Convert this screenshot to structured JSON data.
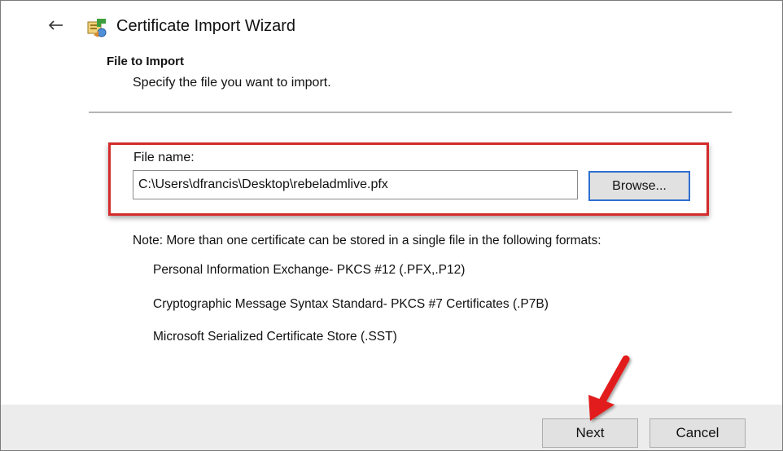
{
  "window": {
    "title": "Certificate Import Wizard"
  },
  "icons": {
    "back": "back-arrow-icon",
    "wizard": "certificate-wizard-icon"
  },
  "page": {
    "heading": "File to Import",
    "description": "Specify the file you want to import."
  },
  "file": {
    "label": "File name:",
    "value": "C:\\Users\\dfrancis\\Desktop\\rebeladmlive.pfx",
    "browse_label": "Browse..."
  },
  "note": {
    "text": "Note:  More than one certificate can be stored in a single file in the following formats:",
    "formats": [
      "Personal Information Exchange- PKCS #12 (.PFX,.P12)",
      "Cryptographic Message Syntax Standard- PKCS #7 Certificates (.P7B)",
      "Microsoft Serialized Certificate Store (.SST)"
    ]
  },
  "footer": {
    "next_label": "Next",
    "cancel_label": "Cancel"
  },
  "colors": {
    "highlight": "#d42b2b",
    "focus_border": "#2f6fd0",
    "footer_bg": "#ececec"
  }
}
